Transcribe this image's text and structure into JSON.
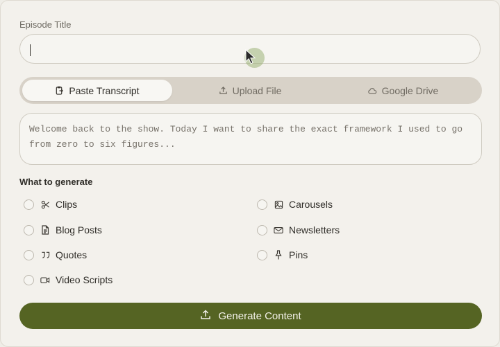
{
  "episode": {
    "label": "Episode Title",
    "value": ""
  },
  "tabs": [
    {
      "label": "Paste Transcript",
      "icon": "paste-icon",
      "active": true
    },
    {
      "label": "Upload File",
      "icon": "upload-icon",
      "active": false
    },
    {
      "label": "Google Drive",
      "icon": "cloud-icon",
      "active": false
    }
  ],
  "transcript": {
    "text": "Welcome back to the show. Today I want to share the exact framework I used to go\nfrom zero to six figures..."
  },
  "generate": {
    "label": "What to generate",
    "options": [
      {
        "label": "Clips",
        "icon": "scissors-icon",
        "selected": false
      },
      {
        "label": "Carousels",
        "icon": "image-icon",
        "selected": false
      },
      {
        "label": "Blog Posts",
        "icon": "document-icon",
        "selected": false
      },
      {
        "label": "Newsletters",
        "icon": "mail-icon",
        "selected": false
      },
      {
        "label": "Quotes",
        "icon": "quote-icon",
        "selected": false
      },
      {
        "label": "Pins",
        "icon": "pin-icon",
        "selected": false
      },
      {
        "label": "Video Scripts",
        "icon": "video-icon",
        "selected": false
      }
    ]
  },
  "action": {
    "label": "Generate Content",
    "icon": "upload-icon",
    "color": "#556423"
  }
}
